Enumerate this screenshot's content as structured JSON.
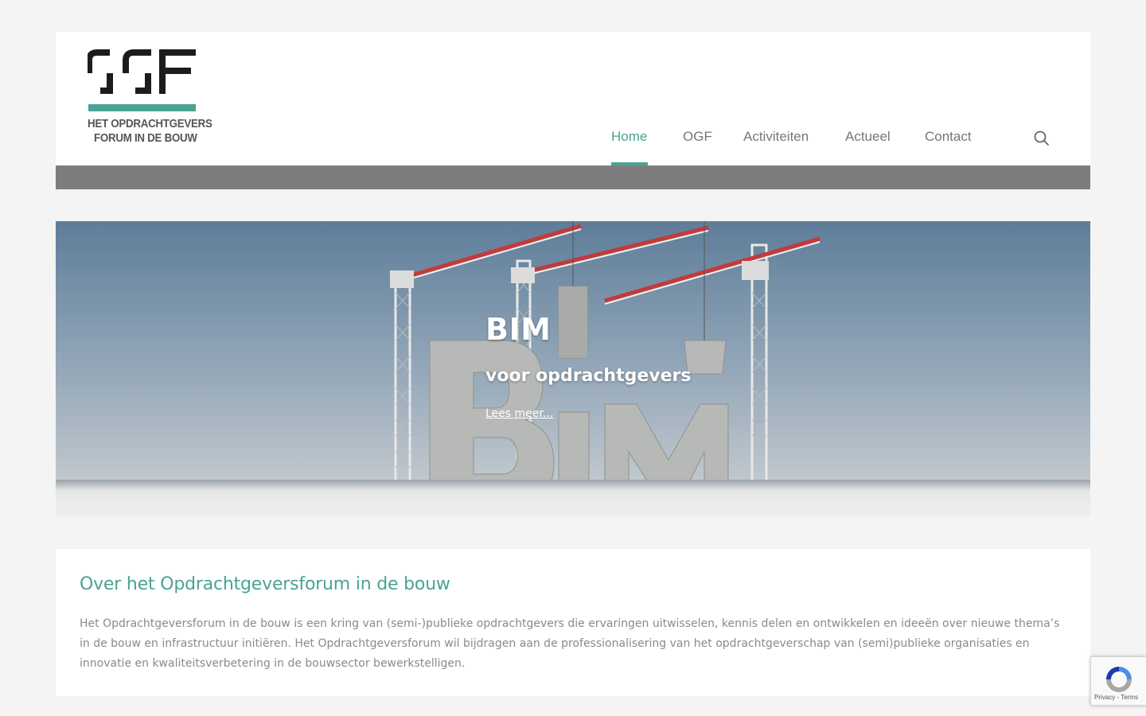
{
  "header": {
    "logo": {
      "text_line1": "HET OPDRACHTGEVERS",
      "text_line2": "FORUM IN DE BOUW",
      "mark": "OGF"
    },
    "nav": [
      {
        "label": "Home",
        "active": true
      },
      {
        "label": "OGF",
        "active": false
      },
      {
        "label": "Activiteiten",
        "active": false
      },
      {
        "label": "Actueel",
        "active": false
      },
      {
        "label": "Contact",
        "active": false
      }
    ],
    "search_icon": "search-icon"
  },
  "hero": {
    "title": "BIM",
    "subtitle": "voor opdrachtgevers",
    "link": "Lees meer..."
  },
  "about": {
    "title": "Over het Opdrachtgeversforum in de bouw",
    "text": "Het Opdrachtgeversforum in de bouw is een kring van (semi-)publieke opdrachtgevers die ervaringen uitwisselen, kennis delen en ontwikkelen en ideeën over nieuwe thema’s in de bouw en infrastructuur initiëren. Het Opdrachtgeversforum wil bijdragen aan de professionalisering van het opdrachtgeverschap van (semi)publieke organisaties en innovatie en kwaliteitsverbetering in de bouwsector bewerkstelligen."
  },
  "recaptcha": {
    "links": "Privacy - Terms"
  },
  "colors": {
    "accent": "#4aa392",
    "page_bg": "#f4f4f4",
    "subbar": "#7d7d7d"
  }
}
